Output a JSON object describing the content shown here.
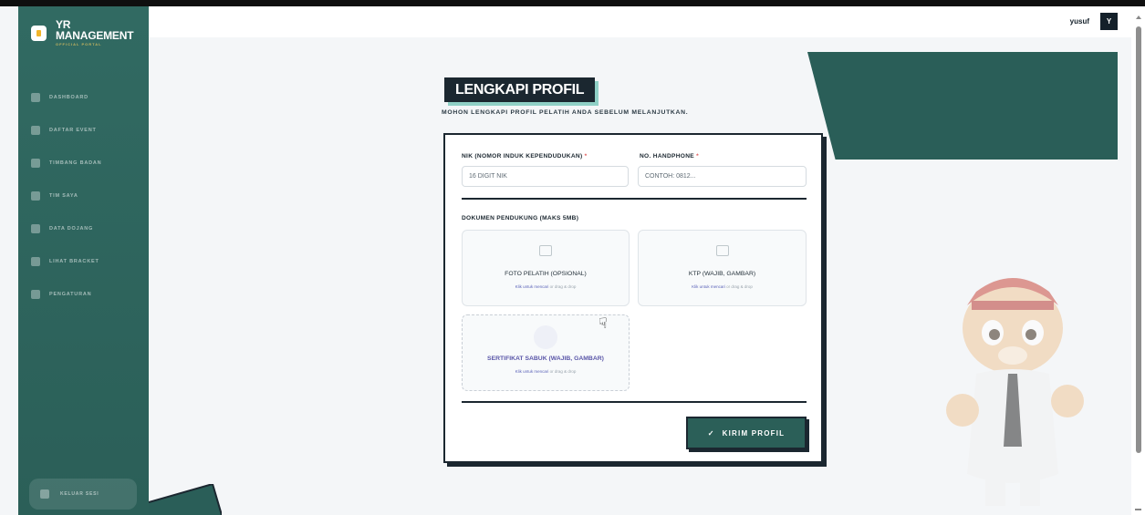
{
  "brand": {
    "title_line1": "YR",
    "title_line2": "MANAGEMENT",
    "subtitle": "OFFICIAL PORTAL"
  },
  "sidebar": {
    "items": [
      {
        "label": "DASHBOARD",
        "icon": "home-icon"
      },
      {
        "label": "DAFTAR EVENT",
        "icon": "calendar-icon"
      },
      {
        "label": "TIMBANG BADAN",
        "icon": "scale-icon"
      },
      {
        "label": "TIM SAYA",
        "icon": "team-icon"
      },
      {
        "label": "DATA DOJANG",
        "icon": "building-icon"
      },
      {
        "label": "LIHAT BRACKET",
        "icon": "bracket-icon"
      },
      {
        "label": "PENGATURAN",
        "icon": "gear-icon"
      }
    ],
    "logout_label": "KELUAR SESI"
  },
  "header": {
    "username": "yusuf",
    "avatar_initial": "Y"
  },
  "page": {
    "title": "LENGKAPI PROFIL",
    "subtitle": "MOHON LENGKAPI PROFIL PELATIH ANDA SEBELUM MELANJUTKAN."
  },
  "form": {
    "nik": {
      "label": "NIK (NOMOR INDUK KEPENDUDUKAN)",
      "placeholder": "16 DIGIT NIK",
      "required_mark": "*"
    },
    "phone": {
      "label": "NO. HANDPHONE",
      "placeholder": "CONTOH: 0812...",
      "required_mark": "*"
    },
    "documents_label": "DOKUMEN PENDUKUNG (MAKS 5MB)",
    "uploads": [
      {
        "title": "FOTO PELATIH (OPSIONAL)",
        "hint_link": "Klik untuk mencari",
        "hint_rest": " or drag & drop"
      },
      {
        "title": "KTP (WAJIB, GAMBAR)",
        "hint_link": "Klik untuk mencari",
        "hint_rest": " or drag & drop"
      },
      {
        "title": "SERTIFIKAT SABUK (WAJIB, GAMBAR)",
        "hint_link": "Klik untuk mencari",
        "hint_rest": " or drag & drop"
      }
    ],
    "submit_label": "KIRIM PROFIL"
  },
  "colors": {
    "primary": "#2b5f58",
    "dark": "#1b2730",
    "accent_shadow": "#8fd0c6",
    "required": "#e05a5a"
  }
}
